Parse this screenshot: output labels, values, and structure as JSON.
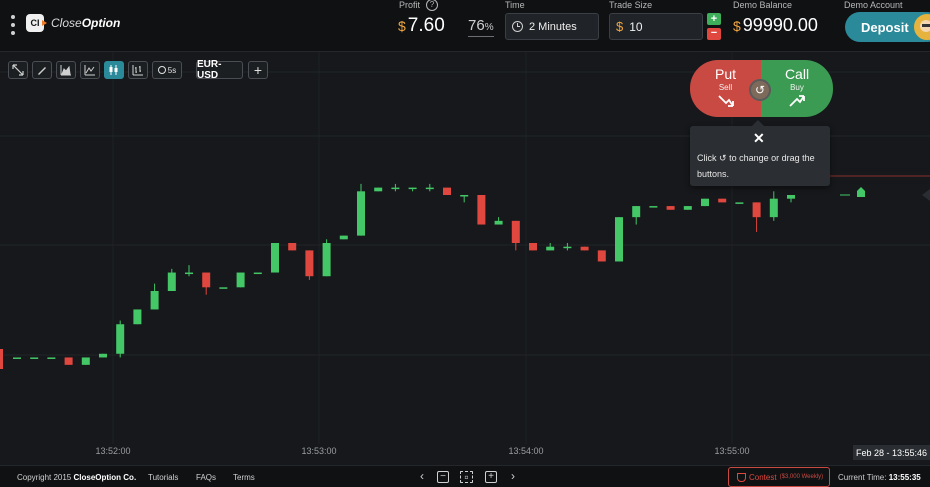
{
  "header": {
    "brand_prefix": "Close",
    "brand_suffix": "Option",
    "logo_mark": "CI",
    "profit_label": "Profit",
    "profit_currency": "$",
    "profit_value": "7.60",
    "payout_percent": "76",
    "payout_percent_sign": "%",
    "time_label": "Time",
    "time_value": "2 Minutes",
    "trade_size_label": "Trade Size",
    "trade_size_currency": "$",
    "trade_size_value": "10",
    "stepper_up": "+",
    "stepper_down": "−",
    "balance_label": "Demo Balance",
    "balance_currency": "$",
    "balance_value": "99990.00",
    "account_label": "Demo Account",
    "deposit_label": "Deposit",
    "help": "?"
  },
  "toolbar": {
    "timeframe": "5s",
    "symbol": "EUR-USD",
    "add_symbol": "+"
  },
  "trade_panel": {
    "put_label": "Put",
    "put_sub": "Sell",
    "call_label": "Call",
    "call_sub": "Buy"
  },
  "tooltip": {
    "close": "✕",
    "text_before": "Click",
    "text_after": "to change or drag the buttons."
  },
  "chart_data": {
    "type": "candlestick",
    "symbol": "EUR-USD",
    "x_tick_labels": [
      "13:52:00",
      "13:53:00",
      "13:54:00",
      "13:55:00"
    ],
    "cursor_timestamp": "Feb 28 - 13:55:46",
    "candles": [
      {
        "open": 43,
        "close": 43,
        "high": 43,
        "low": 43
      },
      {
        "open": 43,
        "close": 43,
        "high": 43,
        "low": 43
      },
      {
        "open": 43,
        "close": 43,
        "high": 43,
        "low": 43
      },
      {
        "open": 43,
        "close": 41,
        "high": 43,
        "low": 41
      },
      {
        "open": 41,
        "close": 43,
        "high": 43,
        "low": 41
      },
      {
        "open": 43,
        "close": 44,
        "high": 44,
        "low": 43
      },
      {
        "open": 44,
        "close": 52,
        "high": 53,
        "low": 43
      },
      {
        "open": 52,
        "close": 56,
        "high": 56,
        "low": 52
      },
      {
        "open": 56,
        "close": 61,
        "high": 63,
        "low": 56
      },
      {
        "open": 61,
        "close": 66,
        "high": 67,
        "low": 61
      },
      {
        "open": 66,
        "close": 66,
        "high": 68,
        "low": 65
      },
      {
        "open": 66,
        "close": 62,
        "high": 66,
        "low": 60
      },
      {
        "open": 62,
        "close": 62,
        "high": 62,
        "low": 62
      },
      {
        "open": 62,
        "close": 66,
        "high": 66,
        "low": 62
      },
      {
        "open": 66,
        "close": 66,
        "high": 66,
        "low": 66
      },
      {
        "open": 66,
        "close": 74,
        "high": 74,
        "low": 66
      },
      {
        "open": 74,
        "close": 72,
        "high": 74,
        "low": 72
      },
      {
        "open": 72,
        "close": 65,
        "high": 72,
        "low": 64
      },
      {
        "open": 65,
        "close": 74,
        "high": 75,
        "low": 65
      },
      {
        "open": 75,
        "close": 76,
        "high": 76,
        "low": 75
      },
      {
        "open": 76,
        "close": 88,
        "high": 90,
        "low": 76
      },
      {
        "open": 88,
        "close": 89,
        "high": 89,
        "low": 88
      },
      {
        "open": 89,
        "close": 89,
        "high": 90,
        "low": 88
      },
      {
        "open": 89,
        "close": 89,
        "high": 89,
        "low": 88
      },
      {
        "open": 89,
        "close": 89,
        "high": 90,
        "low": 88
      },
      {
        "open": 89,
        "close": 87,
        "high": 89,
        "low": 87
      },
      {
        "open": 87,
        "close": 87,
        "high": 87,
        "low": 85
      },
      {
        "open": 87,
        "close": 79,
        "high": 87,
        "low": 79
      },
      {
        "open": 79,
        "close": 80,
        "high": 81,
        "low": 79
      },
      {
        "open": 80,
        "close": 74,
        "high": 80,
        "low": 72
      },
      {
        "open": 74,
        "close": 72,
        "high": 74,
        "low": 72
      },
      {
        "open": 72,
        "close": 73,
        "high": 74,
        "low": 72
      },
      {
        "open": 73,
        "close": 73,
        "high": 74,
        "low": 72
      },
      {
        "open": 73,
        "close": 72,
        "high": 73,
        "low": 72
      },
      {
        "open": 72,
        "close": 69,
        "high": 72,
        "low": 69
      },
      {
        "open": 69,
        "close": 81,
        "high": 81,
        "low": 69
      },
      {
        "open": 81,
        "close": 84,
        "high": 84,
        "low": 79
      },
      {
        "open": 84,
        "close": 84,
        "high": 84,
        "low": 84
      },
      {
        "open": 84,
        "close": 83,
        "high": 84,
        "low": 83
      },
      {
        "open": 83,
        "close": 84,
        "high": 84,
        "low": 83
      },
      {
        "open": 84,
        "close": 86,
        "high": 86,
        "low": 84
      },
      {
        "open": 86,
        "close": 85,
        "high": 86,
        "low": 85
      },
      {
        "open": 85,
        "close": 85,
        "high": 85,
        "low": 85
      },
      {
        "open": 85,
        "close": 81,
        "high": 85,
        "low": 77
      },
      {
        "open": 81,
        "close": 86,
        "high": 88,
        "low": 80
      },
      {
        "open": 86,
        "close": 87,
        "high": 87,
        "low": 85
      }
    ],
    "colors": {
      "up": "#44c767",
      "down": "#e0473e"
    }
  },
  "footer": {
    "copyright_prefix": "Copyright 2015",
    "copyright_company": "CloseOption Co.",
    "tutorials": "Tutorials",
    "faqs": "FAQs",
    "terms": "Terms",
    "contest_label": "Contest",
    "contest_prize": "($3,000 Weekly)",
    "current_time_label": "Current Time:",
    "current_time_value": "13:55:35"
  }
}
